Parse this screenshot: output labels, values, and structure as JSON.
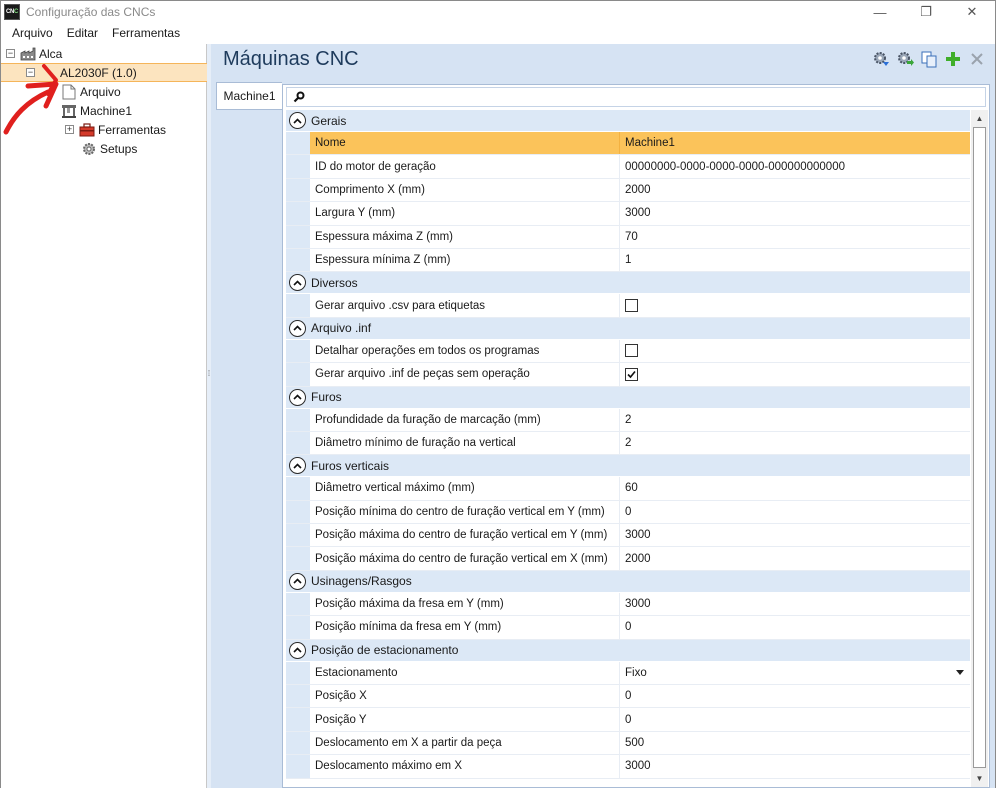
{
  "window": {
    "title": "Configuração das CNCs",
    "icon_text_top": "CN",
    "icon_text_accent": "C",
    "minimize": "—",
    "maximize": "❐",
    "close": "✕"
  },
  "menu": [
    "Arquivo",
    "Editar",
    "Ferramentas"
  ],
  "tree": {
    "root": {
      "label": "Alca",
      "expander": "⊟",
      "icon": "factory-icon"
    },
    "selected": {
      "label": "AL2030F (1.0)",
      "expander": "−",
      "icon": "none"
    },
    "arquivo": {
      "label": "Arquivo",
      "icon": "document-icon"
    },
    "machine": {
      "label": "Machine1",
      "icon": "machine-icon"
    },
    "ferramentas": {
      "label": "Ferramentas",
      "expander": "+",
      "icon": "toolbox-icon"
    },
    "setups": {
      "label": "Setups",
      "icon": "gear-icon"
    }
  },
  "panel": {
    "title": "Máquinas CNC",
    "toolbar": [
      "gear-import-icon",
      "gear-export-icon",
      "copy-icon",
      "add-icon",
      "close-icon"
    ],
    "tab": "Machine1",
    "search_placeholder": ""
  },
  "properties": [
    {
      "category": "Gerais",
      "rows": [
        {
          "name": "Nome",
          "value": "Machine1",
          "selected": true
        },
        {
          "name": "ID do motor de geração",
          "value": "00000000-0000-0000-0000-000000000000"
        },
        {
          "name": "Comprimento X (mm)",
          "value": "2000"
        },
        {
          "name": "Largura Y (mm)",
          "value": "3000"
        },
        {
          "name": "Espessura máxima Z (mm)",
          "value": "70"
        },
        {
          "name": "Espessura mínima Z (mm)",
          "value": "1"
        }
      ]
    },
    {
      "category": "Diversos",
      "rows": [
        {
          "name": "Gerar arquivo .csv para etiquetas",
          "checkbox": true,
          "checked": false
        }
      ]
    },
    {
      "category": "Arquivo .inf",
      "rows": [
        {
          "name": "Detalhar operações em todos os programas",
          "checkbox": true,
          "checked": false
        },
        {
          "name": "Gerar arquivo .inf de peças sem operação",
          "checkbox": true,
          "checked": true
        }
      ]
    },
    {
      "category": "Furos",
      "rows": [
        {
          "name": "Profundidade da furação de marcação (mm)",
          "value": "2"
        },
        {
          "name": "Diâmetro mínimo de furação na vertical",
          "value": "2"
        }
      ]
    },
    {
      "category": "Furos verticais",
      "rows": [
        {
          "name": "Diâmetro vertical máximo (mm)",
          "value": "60"
        },
        {
          "name": "Posição mínima do centro de furação vertical em Y (mm)",
          "value": "0"
        },
        {
          "name": "Posição máxima do centro de furação vertical em Y (mm)",
          "value": "3000"
        },
        {
          "name": "Posição máxima do centro de furação vertical em X (mm)",
          "value": "2000"
        }
      ]
    },
    {
      "category": "Usinagens/Rasgos",
      "rows": [
        {
          "name": "Posição máxima da fresa em Y (mm)",
          "value": "3000"
        },
        {
          "name": "Posição mínima da fresa em Y (mm)",
          "value": "0"
        }
      ]
    },
    {
      "category": "Posição de estacionamento",
      "rows": [
        {
          "name": "Estacionamento",
          "value": "Fixo",
          "dropdown": true
        },
        {
          "name": "Posição X",
          "value": "0"
        },
        {
          "name": "Posição Y",
          "value": "0"
        },
        {
          "name": "Deslocamento em X a partir da peça",
          "value": "500"
        },
        {
          "name": "Deslocamento máximo em X",
          "value": "3000"
        }
      ]
    }
  ],
  "scrollbar": {
    "up": "▲",
    "down": "▼"
  },
  "colors": {
    "selected_row": "#fbc35a",
    "category_bg": "#dce8f6",
    "panel_bg": "#d6e3f3",
    "annotation": "#e0201e"
  }
}
